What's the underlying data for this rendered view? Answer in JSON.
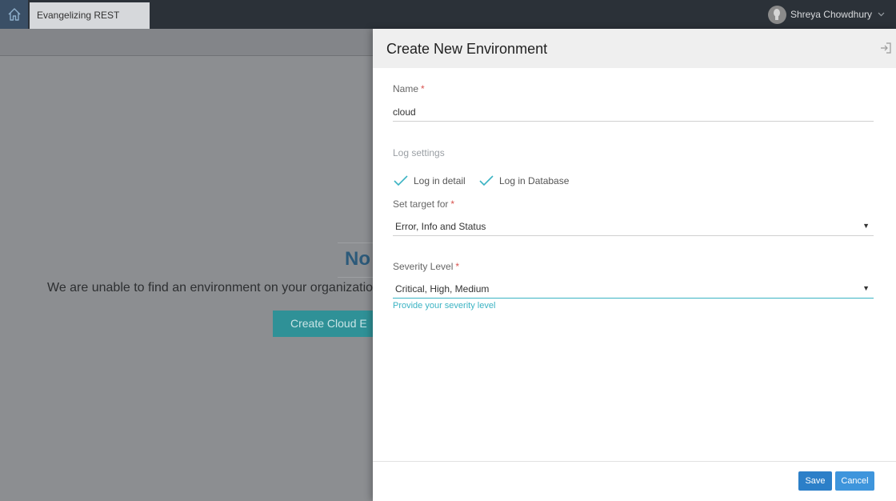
{
  "topbar": {
    "home_icon": "home-icon",
    "tab_label": "Evangelizing REST",
    "user": {
      "name": "Shreya Chowdhury",
      "avatar_icon": "user-avatar-icon",
      "menu_icon": "chevron-down-icon"
    }
  },
  "background_page": {
    "heading_partial": "No",
    "message": "We are unable to find an environment on your organization",
    "button_label": "Create Cloud E"
  },
  "drawer": {
    "title": "Create New Environment",
    "close_icon": "exit-panel-icon",
    "name_field": {
      "label": "Name",
      "required": "*",
      "value": "cloud"
    },
    "log_settings": {
      "section_label": "Log settings",
      "options": [
        {
          "label": "Log in detail",
          "checked": true
        },
        {
          "label": "Log in Database",
          "checked": true
        }
      ]
    },
    "target_field": {
      "label": "Set target for",
      "required": "*",
      "value": "Error, Info and Status"
    },
    "severity_field": {
      "label": "Severity Level",
      "required": "*",
      "value": "Critical, High, Medium",
      "hint": "Provide your severity level"
    },
    "footer": {
      "save_label": "Save",
      "cancel_label": "Cancel"
    }
  },
  "colors": {
    "topbar": "#2b3138",
    "accent": "#3bb3c3",
    "primary_button": "#2c7fc8",
    "required": "#d9534f"
  }
}
